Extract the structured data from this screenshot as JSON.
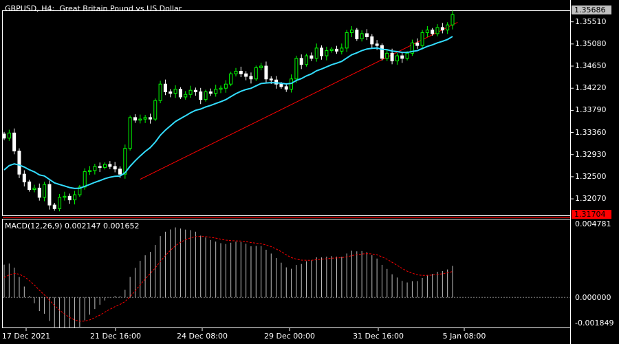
{
  "header": {
    "symbol": "GBPUSD, H4:",
    "description": "Great Britain Pound vs US Dollar"
  },
  "badges": {
    "current_price": "1.35686",
    "horizontal_line": "1.31704"
  },
  "colors": {
    "background": "#000000",
    "frame": "#ffffff",
    "bull_candle": "#00ff00",
    "bear_candle": "#ffffff",
    "moving_average": "#33ddff",
    "trendline": "#ff0000",
    "horizontal_line": "#ff0000",
    "macd_histogram": "#c0c0c0",
    "macd_signal": "#ff0000"
  },
  "macd": {
    "label": "MACD(12,26,9) 0.002147 0.001652",
    "ticks": [
      "0.004781",
      "0.000000",
      "-0.001849"
    ]
  },
  "chart_data": {
    "type": "candlestick",
    "symbol": "GBPUSD",
    "timeframe": "H4",
    "y_ticks": [
      "1.35510",
      "1.35080",
      "1.34650",
      "1.34220",
      "1.33790",
      "1.33360",
      "1.32930",
      "1.32500",
      "1.32070"
    ],
    "x_ticks": [
      "17 Dec 2021",
      "21 Dec 16:00",
      "24 Dec 08:00",
      "29 Dec 00:00",
      "31 Dec 16:00",
      "5 Jan 08:00"
    ],
    "ylim": [
      1.3175,
      1.3572
    ],
    "closes": [
      1.3325,
      1.3335,
      1.33,
      1.3255,
      1.324,
      1.3225,
      1.3228,
      1.321,
      1.3235,
      1.3195,
      1.3188,
      1.321,
      1.3212,
      1.3205,
      1.3215,
      1.323,
      1.326,
      1.3262,
      1.327,
      1.3268,
      1.3274,
      1.327,
      1.3265,
      1.3255,
      1.3305,
      1.3365,
      1.336,
      1.3362,
      1.3365,
      1.3362,
      1.3398,
      1.343,
      1.3415,
      1.3412,
      1.342,
      1.3405,
      1.341,
      1.3418,
      1.3415,
      1.34,
      1.3415,
      1.3412,
      1.342,
      1.3422,
      1.343,
      1.345,
      1.3455,
      1.345,
      1.3445,
      1.344,
      1.3462,
      1.3465,
      1.344,
      1.3438,
      1.343,
      1.3425,
      1.342,
      1.344,
      1.348,
      1.3468,
      1.3485,
      1.348,
      1.35,
      1.3485,
      1.3495,
      1.3498,
      1.3494,
      1.35,
      1.353,
      1.3535,
      1.3518,
      1.3528,
      1.3522,
      1.3508,
      1.3505,
      1.348,
      1.349,
      1.3475,
      1.3485,
      1.348,
      1.349,
      1.351,
      1.3505,
      1.353,
      1.3535,
      1.3528,
      1.354,
      1.3535,
      1.3545,
      1.3565
    ],
    "ma_start": 1.3255,
    "macd_range": [
      -0.001849,
      0.004781
    ],
    "trendline": {
      "from_index": 27,
      "from_price": 1.3245,
      "to_index": 90,
      "to_price": 1.355
    },
    "horizontal_line": 1.31704
  }
}
